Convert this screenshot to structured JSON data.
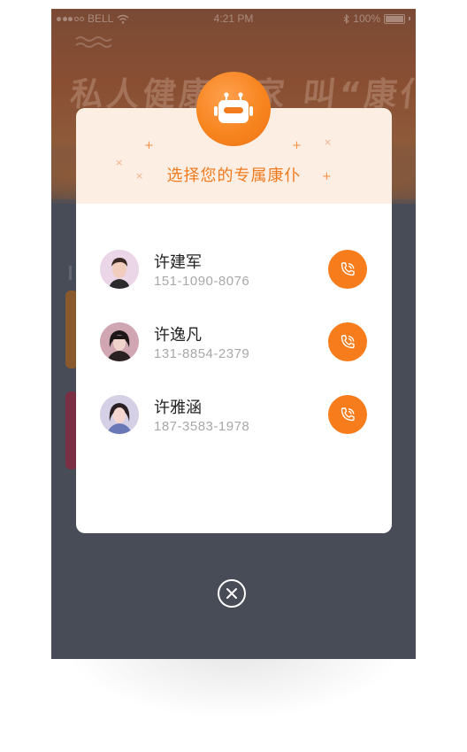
{
  "status_bar": {
    "carrier": "BELL",
    "time": "4:21 PM",
    "battery": "100%"
  },
  "background": {
    "title": "私人健康管家 叫“康仆”"
  },
  "dialog": {
    "title": "选择您的专属康仆",
    "contacts": [
      {
        "name": "许建军",
        "phone": "151-1090-8076"
      },
      {
        "name": "许逸凡",
        "phone": "131-8854-2379"
      },
      {
        "name": "许雅涵",
        "phone": "187-3583-1978"
      }
    ]
  },
  "colors": {
    "accent": "#f77d1c",
    "title": "#f07a1e",
    "header_bg": "#fdeee3",
    "overlay": "#484c57"
  },
  "icons": {
    "robot": "robot-icon",
    "call": "phone-call-icon",
    "close": "close-icon"
  }
}
